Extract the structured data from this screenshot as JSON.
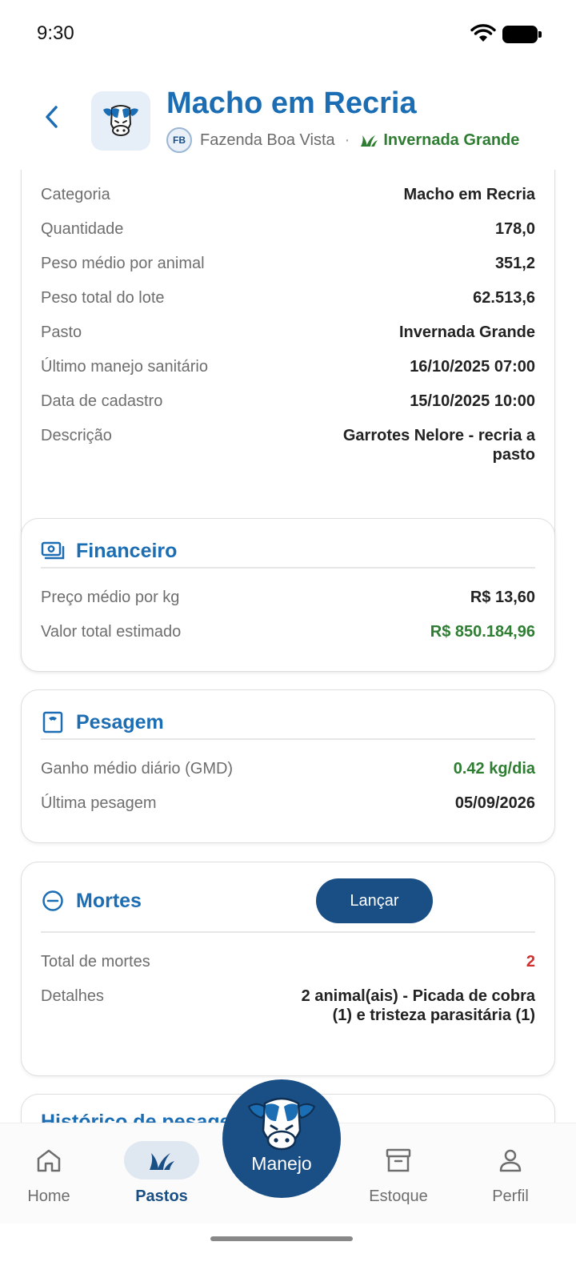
{
  "status": {
    "time": "9:30"
  },
  "header": {
    "title": "Macho em Recria",
    "farm_badge": "FB",
    "farm_name": "Fazenda Boa Vista",
    "separator": "·",
    "pasture_name": "Invernada Grande"
  },
  "details": {
    "rows": [
      {
        "label": "Categoria",
        "value": "Macho em Recria"
      },
      {
        "label": "Quantidade",
        "value": "178,0"
      },
      {
        "label": "Peso médio por animal",
        "value": "351,2"
      },
      {
        "label": "Peso total do lote",
        "value": "62.513,6"
      },
      {
        "label": "Pasto",
        "value": "Invernada Grande"
      },
      {
        "label": "Último manejo sanitário",
        "value": "16/10/2025 07:00"
      },
      {
        "label": "Data de cadastro",
        "value": "15/10/2025 10:00"
      },
      {
        "label": "Descrição",
        "value": "Garrotes Nelore - recria a pasto"
      }
    ]
  },
  "financeiro": {
    "title": "Financeiro",
    "rows": [
      {
        "label": "Preço médio por kg",
        "value": "R$ 13,60"
      },
      {
        "label": "Valor total estimado",
        "value": "R$ 850.184,96"
      }
    ]
  },
  "pesagem": {
    "title": "Pesagem",
    "rows": [
      {
        "label": "Ganho médio diário (GMD)",
        "value": "0.42 kg/dia"
      },
      {
        "label": "Última pesagem",
        "value": "05/09/2026"
      }
    ]
  },
  "mortes": {
    "title": "Mortes",
    "action_label": "Lançar",
    "rows": [
      {
        "label": "Total de mortes",
        "value": "2"
      },
      {
        "label": "Detalhes",
        "value": "2 animal(ais) - Picada de cobra (1) e tristeza parasitária (1)"
      }
    ]
  },
  "historico": {
    "title": "Histórico de pesagens"
  },
  "tabbar": {
    "home": "Home",
    "pastos": "Pastos",
    "manejo": "Manejo",
    "estoque": "Estoque",
    "perfil": "Perfil"
  },
  "colors": {
    "primary": "#1b6db4",
    "dark_primary": "#1a4f86",
    "positive": "#2e7d32",
    "negative": "#d32f2f"
  }
}
